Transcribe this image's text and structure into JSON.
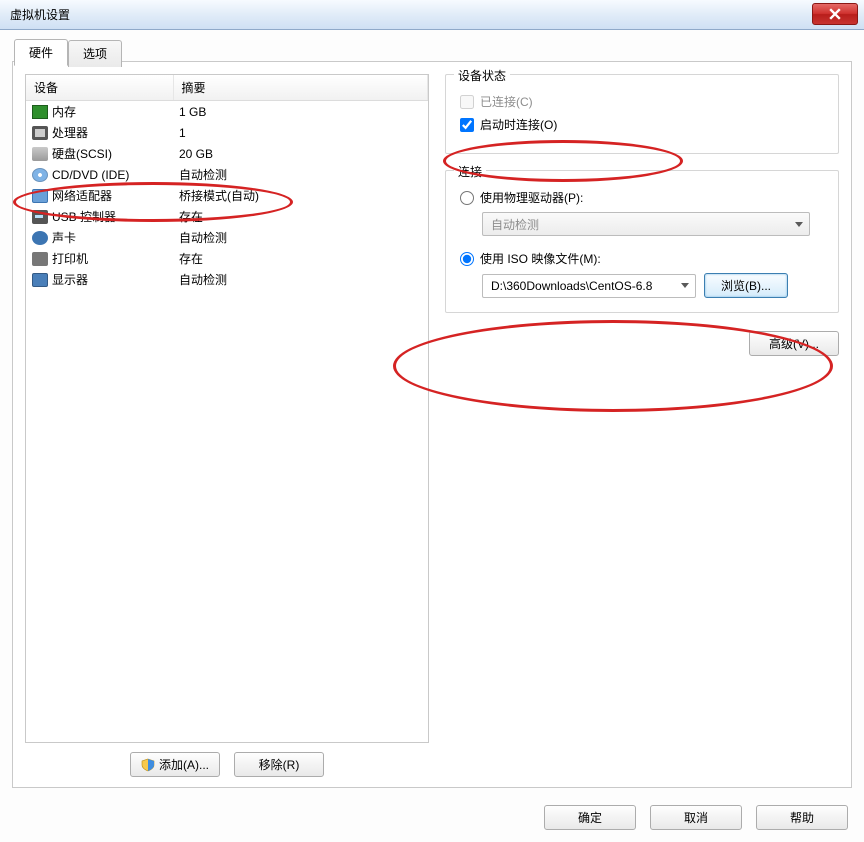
{
  "window": {
    "title": "虚拟机设置"
  },
  "tabs": {
    "hardware": "硬件",
    "options": "选项"
  },
  "table": {
    "col_device": "设备",
    "col_summary": "摘要",
    "rows": [
      {
        "name": "内存",
        "summary": "1 GB",
        "icon": "memory-icon"
      },
      {
        "name": "处理器",
        "summary": "1",
        "icon": "cpu-icon"
      },
      {
        "name": "硬盘(SCSI)",
        "summary": "20 GB",
        "icon": "disk-icon"
      },
      {
        "name": "CD/DVD (IDE)",
        "summary": "自动检测",
        "icon": "cd-icon",
        "selected": false
      },
      {
        "name": "网络适配器",
        "summary": "桥接模式(自动)",
        "icon": "network-icon"
      },
      {
        "name": "USB 控制器",
        "summary": "存在",
        "icon": "usb-icon"
      },
      {
        "name": "声卡",
        "summary": "自动检测",
        "icon": "sound-icon"
      },
      {
        "name": "打印机",
        "summary": "存在",
        "icon": "printer-icon"
      },
      {
        "name": "显示器",
        "summary": "自动检测",
        "icon": "display-icon"
      }
    ]
  },
  "buttons": {
    "add": "添加(A)...",
    "remove": "移除(R)",
    "ok": "确定",
    "cancel": "取消",
    "help": "帮助",
    "browse": "浏览(B)...",
    "advanced": "高级(V)..."
  },
  "group_device_status": {
    "title": "设备状态",
    "connected": "已连接(C)",
    "connect_at_poweron": "启动时连接(O)"
  },
  "group_connection": {
    "title": "连接",
    "use_physical": "使用物理驱动器(P):",
    "physical_value": "自动检测",
    "use_iso": "使用 ISO 映像文件(M):",
    "iso_value": "D:\\360Downloads\\CentOS-6.8"
  }
}
